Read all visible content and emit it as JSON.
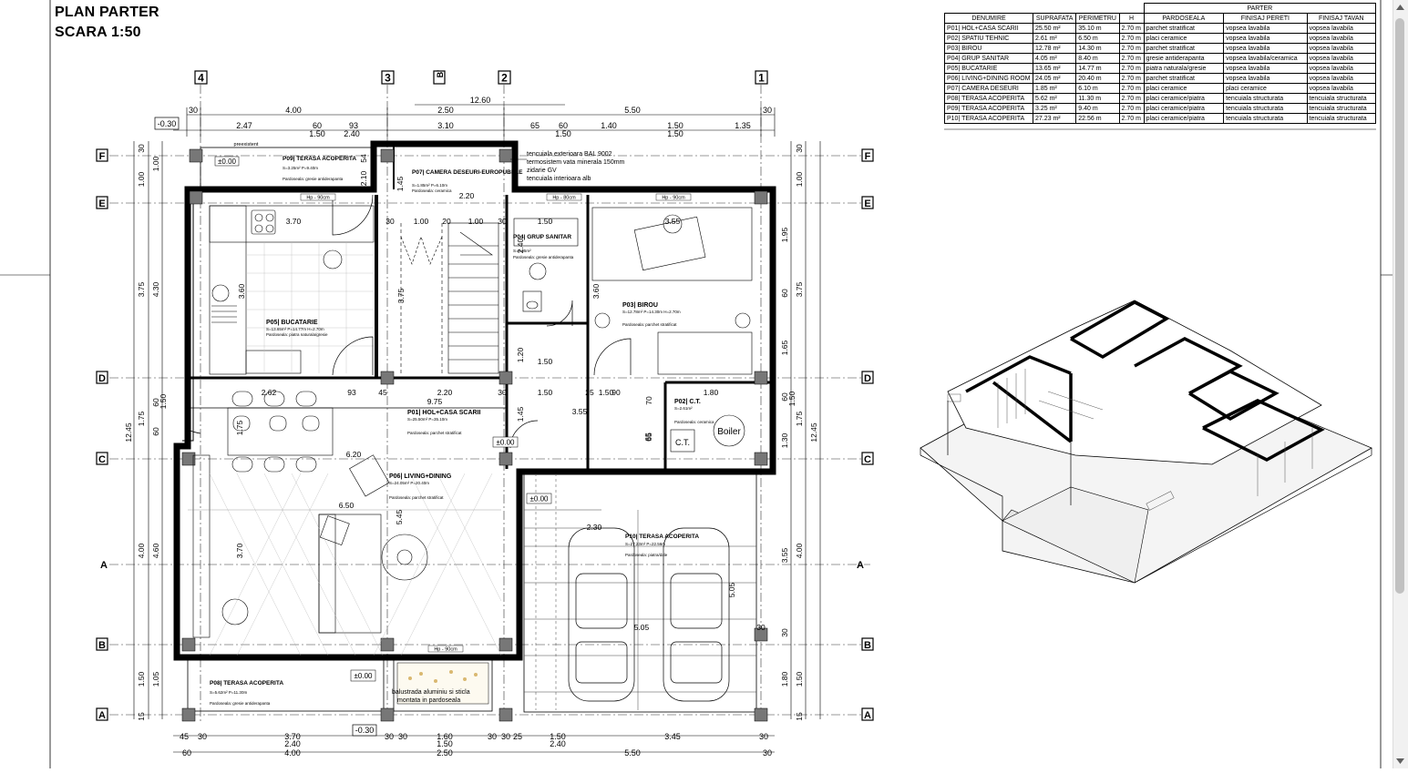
{
  "sheet": {
    "title_line1": "PLAN PARTER",
    "title_line2": "SCARA 1:50"
  },
  "schedule": {
    "group_header": "PARTER",
    "columns": [
      "DENUMIRE",
      "SUPRAFATA",
      "PERIMETRU",
      "H",
      "PARDOSEALA",
      "FINISAJ PERETI",
      "FINISAJ TAVAN"
    ],
    "rows": [
      [
        "P01| HOL+CASA SCARII",
        "25.50 m²",
        "35.10 m",
        "2.70 m",
        "parchet stratificat",
        "vopsea lavabila",
        "vopsea lavabila"
      ],
      [
        "P02| SPATIU TEHNIC",
        "2.61 m²",
        "6.50 m",
        "2.70 m",
        "placi ceramice",
        "vopsea lavabila",
        "vopsea lavabila"
      ],
      [
        "P03| BIROU",
        "12.78 m²",
        "14.30 m",
        "2.70 m",
        "parchet stratificat",
        "vopsea lavabila",
        "vopsea lavabila"
      ],
      [
        "P04| GRUP SANITAR",
        "4.05 m²",
        "8.40 m",
        "2.70 m",
        "gresie antiderapanta",
        "vopsea lavabila/ceramica",
        "vopsea lavabila"
      ],
      [
        "P05| BUCATARIE",
        "13.65 m²",
        "14.77 m",
        "2.70 m",
        "piatra naturala/gresie",
        "vopsea lavabila",
        "vopsea lavabila"
      ],
      [
        "P06| LIVING+DINING ROOM",
        "24.05 m²",
        "20.40 m",
        "2.70 m",
        "parchet stratificat",
        "vopsea lavabila",
        "vopsea lavabila"
      ],
      [
        "P07| CAMERA DESEURI",
        "1.85 m²",
        "6.10 m",
        "2.70 m",
        "placi ceramice",
        "placi ceramice",
        "vopsea lavabila"
      ],
      [
        "P08| TERASA ACOPERITA",
        "5.62 m²",
        "11.30 m",
        "2.70 m",
        "placi ceramice/piatra",
        "tencuiala structurata",
        "tencuiala structurata"
      ],
      [
        "P09| TERASA ACOPERITA",
        "3.25 m²",
        "9.40 m",
        "2.70 m",
        "placi ceramice/piatra",
        "tencuiala structurata",
        "tencuiala structurata"
      ],
      [
        "P10| TERASA ACOPERITA",
        "27.23 m²",
        "22.56 m",
        "2.70 m",
        "placi ceramice/piatra",
        "tencuiala structurata",
        "tencuiala structurata"
      ]
    ]
  },
  "plan": {
    "axes_vertical": [
      "4",
      "3",
      "2",
      "1"
    ],
    "axis_b_prime": "B'",
    "axes_horizontal": [
      "F",
      "E",
      "D",
      "C",
      "A",
      "B",
      "A"
    ],
    "top_dims_row1": [
      "30",
      "4.00",
      "2.50",
      "5.50",
      "30"
    ],
    "top_dims_row2": [
      "2.47",
      "60",
      "93",
      "3.10",
      "65",
      "60",
      "1.40",
      "1.50",
      "1.35"
    ],
    "top_dims_row2_sub": [
      "1.50",
      "2.40",
      "1.50",
      "1.50"
    ],
    "top_mid_dim": "12.60",
    "level_top_left": "-0.30",
    "level_bottom": "-0.30",
    "levels_zero": [
      "±0.00",
      "±0.00",
      "±0.00",
      "±0.00"
    ],
    "bottom_dims_row1": [
      "45",
      "30",
      "3.70",
      "30",
      "30",
      "1.60",
      "30",
      "30",
      "25",
      "1.50",
      "3.45",
      "30"
    ],
    "bottom_dims_row1_sub": [
      "2.40",
      "1.50",
      "2.40"
    ],
    "bottom_dims_row2": [
      "60",
      "4.00",
      "2.50",
      "5.50",
      "30"
    ],
    "left_dims": [
      "30",
      "1.00",
      "1.00",
      "3.75",
      "4.30",
      "60",
      "1.50",
      "1.75",
      "60",
      "12.45",
      "4.00",
      "4.60",
      "1.50",
      "1.05",
      "15"
    ],
    "right_dims": [
      "30",
      "1.00",
      "1.95",
      "60",
      "3.75",
      "1.65",
      "60",
      "1.50",
      "1.75",
      "1.30",
      "12.45",
      "3.55",
      "4.00",
      "30",
      "1.80",
      "1.50",
      "15"
    ],
    "wall_note": [
      "tencuiala exterioara BAL 9002",
      "termosistem vata minerala 150mm",
      "zidarie GV",
      "tencuiala interioara alb"
    ],
    "rooms": [
      {
        "name": "P05| BUCATARIE",
        "meta": "S=13.65m²  P=14.77m  H=2.70m",
        "floor": "Pardoseala: piatra naturala/gresie"
      },
      {
        "name": "P07| CAMERA DESEURI-EUROPUBELE",
        "meta": "S=1.85m²  P=6.10m",
        "floor": "Pardoseala: ceramica"
      },
      {
        "name": "P04| GRUP SANITAR",
        "meta": "S=4.05m²",
        "floor": "Pardoseala: gresie antiderapanta"
      },
      {
        "name": "P03| BIROU",
        "meta": "S=12.78m²  P=14.30m  H=2.70m",
        "floor": "Pardoseala: parchet stratificat"
      },
      {
        "name": "P01| HOL+CASA SCARII",
        "meta": "S=25.50m²  P=35.10m",
        "floor": "Pardoseala: parchet stratificat"
      },
      {
        "name": "P02| C.T.",
        "meta": "S=2.61m²",
        "floor": "Pardoseala: ceramica"
      },
      {
        "name": "P06| LIVING+DINING",
        "meta": "S=24.05m²  P=20.40m",
        "floor": "Pardoseala: parchet stratificat"
      },
      {
        "name": "P09| TERASA ACOPERITA",
        "meta": "S=3.25m²  P=9.40m",
        "floor": "Pardoseala: gresie antiderapanta"
      },
      {
        "name": "P08| TERASA ACOPERITA",
        "meta": "S=5.62m²  P=11.30m",
        "floor": "Pardoseala: gresie antiderapanta"
      },
      {
        "name": "P10| TERASA ACOPERITA",
        "meta": "S=27.23m²  P=22.56m",
        "floor": "Pardoseala: piatra/dale"
      }
    ],
    "boiler_label": "Boiler",
    "ct_label": "C.T.",
    "railing_note": [
      "balustrada aluminiu si sticla",
      "montata in pardoseala"
    ],
    "small_dims": [
      "3.70",
      "3.60",
      "3.75",
      "3.60",
      "2.20",
      "1.50",
      "1.50",
      "1.50",
      "1.20",
      "2.62",
      "93",
      "45",
      "2.20",
      "9.75",
      "1.50",
      "25",
      "90",
      "1.80",
      "3.55",
      "1.75",
      "6.20",
      "6.50",
      "5.45",
      "3.70",
      "1.45",
      "70",
      "65",
      "2.30",
      "5.05",
      "5.05",
      "3.55",
      "2.10",
      "54",
      "1.45",
      "2.40",
      "1.00",
      "1.00",
      "20",
      "30",
      "30",
      "30",
      "30",
      "65"
    ],
    "window_tags": [
      "Hp - 90cm",
      "Hp - 90cm",
      "Hp - 80cm",
      "Hp - 90cm"
    ],
    "note_preexisting": "preexistent"
  }
}
